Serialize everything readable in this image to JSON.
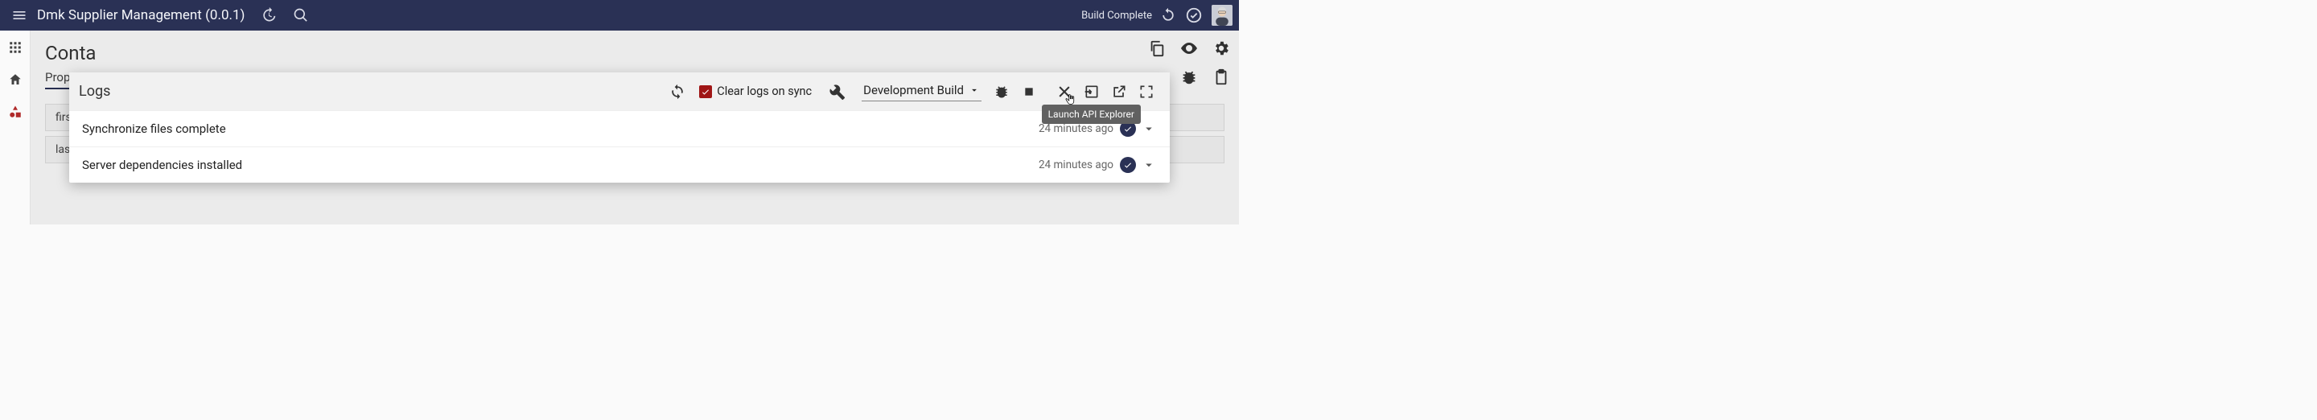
{
  "appbar": {
    "title": "Dmk Supplier Management (0.0.1)",
    "status": "Build Complete"
  },
  "page": {
    "title": "Conta",
    "tab": "Proper",
    "rows": [
      "firstNa",
      "lastNa"
    ]
  },
  "logs": {
    "title": "Logs",
    "clear_label": "Clear logs on sync",
    "build_select": "Development Build",
    "tooltip": "Launch API Explorer",
    "entries": [
      {
        "message": "Synchronize files complete",
        "time": "24 minutes ago"
      },
      {
        "message": "Server dependencies installed",
        "time": "24 minutes ago"
      }
    ]
  }
}
